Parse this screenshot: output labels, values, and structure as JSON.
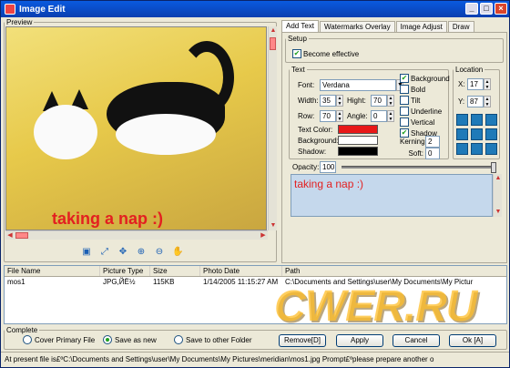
{
  "window": {
    "title": "Image Edit",
    "min": "_",
    "max": "□",
    "close": "×"
  },
  "preview": {
    "legend": "Preview",
    "overlay_text": "taking a nap :)"
  },
  "toolbar_icons": [
    "image-icon",
    "fit-icon",
    "move-icon",
    "zoom-in-icon",
    "zoom-out-icon",
    "hand-icon"
  ],
  "tabs": [
    "Add Text",
    "Watermarks Overlay",
    "Image Adjust",
    "Draw"
  ],
  "setup": {
    "legend": "Setup",
    "become_effective": "Become effective"
  },
  "text": {
    "legend": "Text",
    "font_label": "Font:",
    "font_value": "Verdana",
    "width_label": "Width:",
    "width_value": "35",
    "hight_label": "Hight:",
    "hight_value": "70",
    "row_label": "Row:",
    "row_value": "70",
    "angle_label": "Angle:",
    "angle_value": "0",
    "text_color_label": "Text Color:",
    "background_label": "Background:",
    "shadow_label": "Shadow:",
    "text_color": "#e81818",
    "background_color": "#ffffff",
    "shadow_color": "#000000",
    "options": [
      {
        "label": "Background",
        "checked": true
      },
      {
        "label": "Bold",
        "checked": false
      },
      {
        "label": "Tilt",
        "checked": false
      },
      {
        "label": "Underline",
        "checked": false
      },
      {
        "label": "Vertical",
        "checked": false
      },
      {
        "label": "Shadow",
        "checked": true
      }
    ],
    "kerning_label": "Kerning:",
    "kerning_value": "2",
    "soft_label": "Soft:",
    "soft_value": "0"
  },
  "location": {
    "legend": "Location",
    "x_label": "X:",
    "x_value": "17",
    "y_label": "Y:",
    "y_value": "87"
  },
  "opacity": {
    "label": "Opacity:",
    "value": "100"
  },
  "text_content": "taking a nap :)",
  "list": {
    "columns": [
      "File Name",
      "Picture Type",
      "Size",
      "Photo Date",
      "Path"
    ],
    "rows": [
      [
        "mos1",
        "JPG,ЙЁ½",
        "115KB",
        "1/14/2005 11:15:27 AM",
        "C:\\Documents and Settings\\user\\My Documents\\My Pictur"
      ]
    ]
  },
  "complete": {
    "legend": "Complete",
    "cover": "Cover Primary File",
    "save_new": "Save as new",
    "save_other": "Save to other Folder",
    "remove": "Remove[D]",
    "apply": "Apply",
    "cancel": "Cancel",
    "ok": "Ok [A]"
  },
  "status": "At present file is£ºC:\\Documents and Settings\\user\\My Documents\\My Pictures\\meridian\\mos1.jpg  Prompt£ºplease prepare another o",
  "watermark": "CWER.RU"
}
